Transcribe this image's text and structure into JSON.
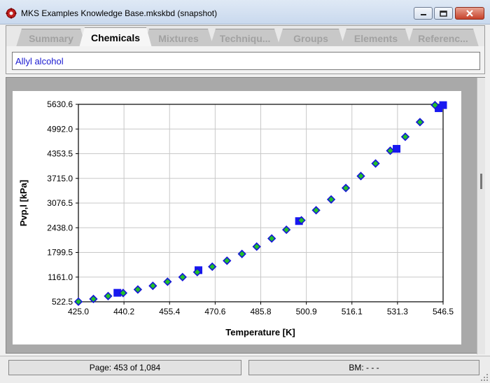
{
  "window": {
    "title": "MKS Examples Knowledge Base.mkskbd (snapshot)",
    "icon": "cog-gear-icon"
  },
  "tabs": [
    {
      "label": "Summary",
      "active": false
    },
    {
      "label": "Chemicals",
      "active": true
    },
    {
      "label": "Mixtures",
      "active": false
    },
    {
      "label": "Techniqu...",
      "active": false
    },
    {
      "label": "Groups",
      "active": false
    },
    {
      "label": "Elements",
      "active": false
    },
    {
      "label": "Referenc...",
      "active": false
    }
  ],
  "chemical_name": "Allyl alcohol",
  "colors": {
    "text_accent": "#1a1ad0",
    "marker_fill": "#22c02a",
    "marker_edge": "#1414d8",
    "square": "#1818f0"
  },
  "chart_data": {
    "type": "scatter",
    "xlabel": "Temperature [K]",
    "ylabel": "Pvp,l [kPa]",
    "xlim": [
      425.0,
      546.5
    ],
    "ylim": [
      522.5,
      5630.6
    ],
    "xticks": [
      "425.0",
      "440.2",
      "455.4",
      "470.6",
      "485.8",
      "500.9",
      "516.1",
      "531.3",
      "546.5"
    ],
    "yticks": [
      "522.5",
      "1161.0",
      "1799.5",
      "2438.0",
      "3076.5",
      "3715.0",
      "4353.5",
      "4992.0",
      "5630.6"
    ],
    "grid": true,
    "series": [
      {
        "marker": "diamond",
        "x": [
          425.0,
          430.0,
          434.9,
          439.9,
          444.8,
          449.8,
          454.7,
          459.7,
          464.6,
          469.6,
          474.5,
          479.5,
          484.4,
          489.4,
          494.3,
          499.3,
          504.2,
          509.2,
          514.1,
          519.1,
          524.0,
          528.9,
          533.9,
          538.8,
          543.8
        ],
        "y": [
          525,
          595,
          670,
          750,
          840,
          935,
          1040,
          1160,
          1290,
          1430,
          1585,
          1760,
          1950,
          2160,
          2385,
          2630,
          2890,
          3170,
          3465,
          3775,
          4100,
          4430,
          4790,
          5170,
          5610
        ]
      },
      {
        "marker": "square",
        "x": [
          438.0,
          465.0,
          498.5,
          531.0,
          545.0,
          546.5
        ],
        "y": [
          755,
          1340,
          2610,
          4480,
          5530,
          5610
        ]
      }
    ]
  },
  "status": {
    "page": "Page: 453 of 1,084",
    "bm": "BM: - - -"
  }
}
